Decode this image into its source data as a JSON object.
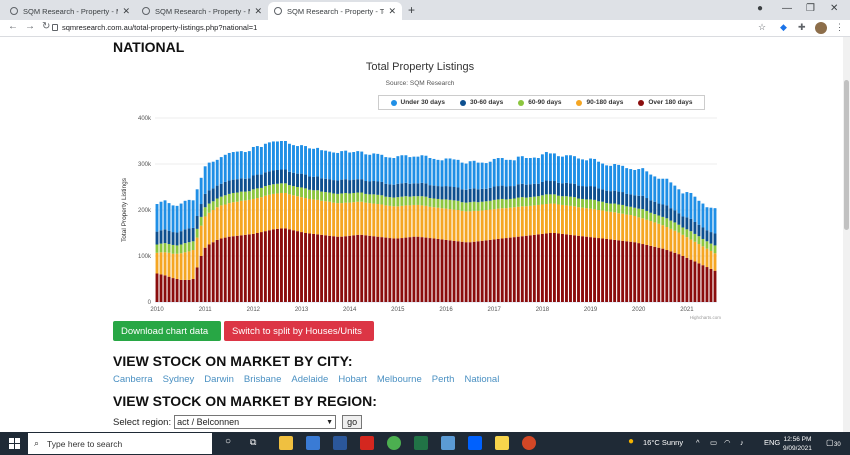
{
  "browser": {
    "tabs": [
      {
        "title": "SQM Research - Property - My R",
        "active": false
      },
      {
        "title": "SQM Research - Property - My R",
        "active": false
      },
      {
        "title": "SQM Research - Property - Total",
        "active": true
      }
    ],
    "url": "sqmresearch.com.au/total-property-listings.php?national=1"
  },
  "page": {
    "heading": "NATIONAL",
    "download_button": "Download chart data",
    "split_button": "Switch to split by Houses/Units",
    "city_heading": "VIEW STOCK ON MARKET BY CITY:",
    "cities": [
      "Canberra",
      "Sydney",
      "Darwin",
      "Brisbane",
      "Adelaide",
      "Hobart",
      "Melbourne",
      "Perth",
      "National"
    ],
    "region_heading": "VIEW STOCK ON MARKET BY REGION:",
    "region_label": "Select region:",
    "region_selected": "act / Belconnen",
    "go_label": "go"
  },
  "chart_data": {
    "type": "bar",
    "stacked": true,
    "title": "Total Property Listings",
    "subtitle": "Source: SQM Research",
    "ylabel": "Total Property Listings",
    "ylim": [
      0,
      400000
    ],
    "yticks": [
      "0",
      "100k",
      "200k",
      "300k",
      "400k"
    ],
    "xticks": [
      "2010",
      "2011",
      "2012",
      "2013",
      "2014",
      "2015",
      "2016",
      "2017",
      "2018",
      "2019",
      "2020",
      "2021"
    ],
    "credit": "Highcharts.com",
    "legend_position": "top-right",
    "grid": true,
    "series_names": [
      "Under 30 days",
      "30-60 days",
      "60-90 days",
      "90-180 days",
      "Over 180 days"
    ],
    "colors": [
      "#1f8fe6",
      "#0d4f8f",
      "#8cc63e",
      "#f5a623",
      "#8b0d0d"
    ],
    "x_start": "2010-01",
    "x_end": "2021-08",
    "series": [
      {
        "name": "Under 30 days",
        "values": [
          60000,
          62000,
          63000,
          60000,
          58000,
          58000,
          60000,
          62000,
          62000,
          60000,
          58000,
          57000,
          60000,
          60000,
          58000,
          56000,
          58000,
          59000,
          60000,
          60000,
          60000,
          59000,
          58000,
          59000,
          62000,
          62000,
          60000,
          62000,
          63000,
          63000,
          62000,
          62000,
          62000,
          61000,
          60000,
          60000,
          62000,
          62000,
          61000,
          61000,
          62000,
          61000,
          61000,
          60000,
          60000,
          60000,
          62000,
          62000,
          60000,
          60000,
          61000,
          60000,
          58000,
          58000,
          60000,
          60000,
          59000,
          58000,
          58000,
          58000,
          60000,
          61000,
          60000,
          58000,
          58000,
          58000,
          60000,
          60000,
          59000,
          58000,
          57000,
          57000,
          60000,
          61000,
          60000,
          60000,
          58000,
          57000,
          60000,
          60000,
          58000,
          57000,
          56000,
          57000,
          60000,
          61000,
          60000,
          58000,
          57000,
          56000,
          60000,
          60000,
          58000,
          57000,
          57000,
          56000,
          60000,
          62000,
          60000,
          60000,
          58000,
          58000,
          60000,
          61000,
          60000,
          59000,
          58000,
          57000,
          60000,
          60000,
          58000,
          56000,
          55000,
          55000,
          58000,
          58000,
          57000,
          56000,
          55000,
          55000,
          58000,
          60000,
          58000,
          56000,
          55000,
          54000,
          56000,
          58000,
          56000,
          54000,
          52000,
          50000,
          55000,
          56000,
          55000,
          52000,
          52000,
          50000,
          53000,
          55000
        ]
      },
      {
        "name": "30-60 days",
        "values": [
          28000,
          29000,
          30000,
          29000,
          28000,
          28000,
          29000,
          30000,
          30000,
          29000,
          28000,
          28000,
          29000,
          29000,
          28000,
          28000,
          28000,
          29000,
          29000,
          29000,
          29000,
          29000,
          28000,
          28000,
          30000,
          30000,
          29000,
          30000,
          30000,
          30000,
          30000,
          30000,
          30000,
          29000,
          29000,
          29000,
          30000,
          30000,
          29000,
          29000,
          30000,
          29000,
          29000,
          29000,
          29000,
          29000,
          30000,
          30000,
          29000,
          29000,
          29000,
          29000,
          28000,
          28000,
          29000,
          29000,
          29000,
          28000,
          28000,
          28000,
          29000,
          29000,
          29000,
          28000,
          28000,
          28000,
          29000,
          29000,
          28000,
          28000,
          28000,
          28000,
          29000,
          29000,
          29000,
          29000,
          28000,
          28000,
          29000,
          29000,
          28000,
          28000,
          27000,
          28000,
          29000,
          29000,
          29000,
          28000,
          28000,
          27000,
          29000,
          29000,
          28000,
          28000,
          28000,
          27000,
          29000,
          30000,
          29000,
          29000,
          28000,
          28000,
          29000,
          29000,
          29000,
          28000,
          28000,
          28000,
          29000,
          29000,
          28000,
          27000,
          27000,
          27000,
          28000,
          28000,
          28000,
          27000,
          27000,
          27000,
          28000,
          29000,
          28000,
          27000,
          27000,
          26000,
          27000,
          28000,
          27000,
          26000,
          25000,
          24000,
          26000,
          27000,
          26000,
          25000,
          25000,
          24000,
          25000,
          26000
        ]
      },
      {
        "name": "60-90 days",
        "values": [
          18000,
          19000,
          20000,
          19000,
          19000,
          18000,
          19000,
          20000,
          20000,
          19000,
          19000,
          19000,
          20000,
          20000,
          19000,
          19000,
          19000,
          20000,
          20000,
          20000,
          20000,
          20000,
          19000,
          19000,
          21000,
          21000,
          20000,
          21000,
          21000,
          21000,
          21000,
          21000,
          21000,
          20000,
          20000,
          20000,
          21000,
          21000,
          20000,
          20000,
          21000,
          20000,
          20000,
          20000,
          20000,
          20000,
          21000,
          21000,
          20000,
          20000,
          20000,
          20000,
          19000,
          19000,
          20000,
          20000,
          20000,
          19000,
          19000,
          19000,
          20000,
          20000,
          20000,
          19000,
          19000,
          19000,
          20000,
          20000,
          19000,
          19000,
          19000,
          19000,
          20000,
          20000,
          20000,
          20000,
          19000,
          19000,
          20000,
          20000,
          19000,
          19000,
          19000,
          19000,
          20000,
          20000,
          20000,
          19000,
          19000,
          19000,
          20000,
          20000,
          19000,
          19000,
          19000,
          19000,
          20000,
          21000,
          20000,
          20000,
          19000,
          19000,
          20000,
          20000,
          20000,
          19000,
          19000,
          19000,
          20000,
          20000,
          19000,
          19000,
          18000,
          18000,
          19000,
          19000,
          19000,
          18000,
          18000,
          18000,
          19000,
          20000,
          19000,
          18000,
          18000,
          18000,
          18000,
          19000,
          18000,
          18000,
          17000,
          16000,
          17000,
          18000,
          17000,
          17000,
          16000,
          16000,
          16000,
          17000
        ]
      },
      {
        "name": "90-180 days",
        "values": [
          45000,
          48000,
          50000,
          52000,
          53000,
          55000,
          58000,
          60000,
          62000,
          63000,
          65000,
          66000,
          68000,
          69000,
          70000,
          71000,
          72000,
          72000,
          73000,
          74000,
          74000,
          75000,
          75000,
          75000,
          76000,
          76000,
          76000,
          77000,
          77000,
          77000,
          77000,
          77000,
          77000,
          76000,
          76000,
          76000,
          76000,
          76000,
          75000,
          75000,
          75000,
          74000,
          74000,
          74000,
          73000,
          73000,
          73000,
          73000,
          72000,
          72000,
          72000,
          72000,
          71000,
          71000,
          71000,
          71000,
          71000,
          70000,
          70000,
          70000,
          70000,
          70000,
          70000,
          69000,
          69000,
          69000,
          69000,
          69000,
          68000,
          68000,
          68000,
          68000,
          68000,
          68000,
          68000,
          68000,
          67000,
          67000,
          67000,
          67000,
          66000,
          66000,
          66000,
          66000,
          66000,
          66000,
          66000,
          65000,
          65000,
          65000,
          65000,
          65000,
          64000,
          64000,
          64000,
          64000,
          64000,
          64000,
          64000,
          64000,
          63000,
          63000,
          63000,
          63000,
          63000,
          62000,
          62000,
          62000,
          62000,
          62000,
          61000,
          61000,
          60000,
          60000,
          60000,
          59000,
          59000,
          58000,
          58000,
          57000,
          56000,
          56000,
          55000,
          54000,
          53000,
          52000,
          51000,
          50000,
          49000,
          48000,
          47000,
          46000,
          45000,
          44000,
          43000,
          42000,
          41000,
          40000,
          39000,
          38000
        ]
      },
      {
        "name": "Over 180 days",
        "values": [
          62000,
          60000,
          58000,
          55000,
          52000,
          50000,
          48000,
          48000,
          48000,
          50000,
          75000,
          100000,
          118000,
          125000,
          130000,
          135000,
          138000,
          140000,
          142000,
          143000,
          144000,
          145000,
          146000,
          147000,
          148000,
          150000,
          152000,
          154000,
          156000,
          158000,
          159000,
          160000,
          160000,
          158000,
          156000,
          154000,
          152000,
          150000,
          149000,
          148000,
          147000,
          146000,
          145000,
          144000,
          143000,
          142000,
          142000,
          143000,
          144000,
          145000,
          146000,
          146000,
          145000,
          144000,
          143000,
          142000,
          141000,
          140000,
          139000,
          138000,
          138000,
          139000,
          140000,
          141000,
          142000,
          142000,
          141000,
          140000,
          139000,
          138000,
          137000,
          136000,
          135000,
          134000,
          133000,
          132000,
          131000,
          130000,
          130000,
          131000,
          132000,
          133000,
          134000,
          135000,
          136000,
          137000,
          138000,
          139000,
          140000,
          141000,
          142000,
          143000,
          144000,
          145000,
          146000,
          147000,
          148000,
          149000,
          150000,
          150000,
          149000,
          148000,
          147000,
          146000,
          145000,
          144000,
          143000,
          142000,
          141000,
          140000,
          139000,
          138000,
          137000,
          136000,
          135000,
          134000,
          133000,
          132000,
          131000,
          130000,
          128000,
          126000,
          124000,
          122000,
          120000,
          118000,
          116000,
          113000,
          110000,
          107000,
          104000,
          100000,
          96000,
          92000,
          88000,
          84000,
          80000,
          76000,
          72000,
          68000
        ]
      }
    ]
  },
  "taskbar": {
    "search_placeholder": "Type here to search",
    "weather": "16°C  Sunny",
    "lang": "ENG",
    "time": "12:56 PM",
    "date": "9/09/2021",
    "notif_count": "30"
  }
}
